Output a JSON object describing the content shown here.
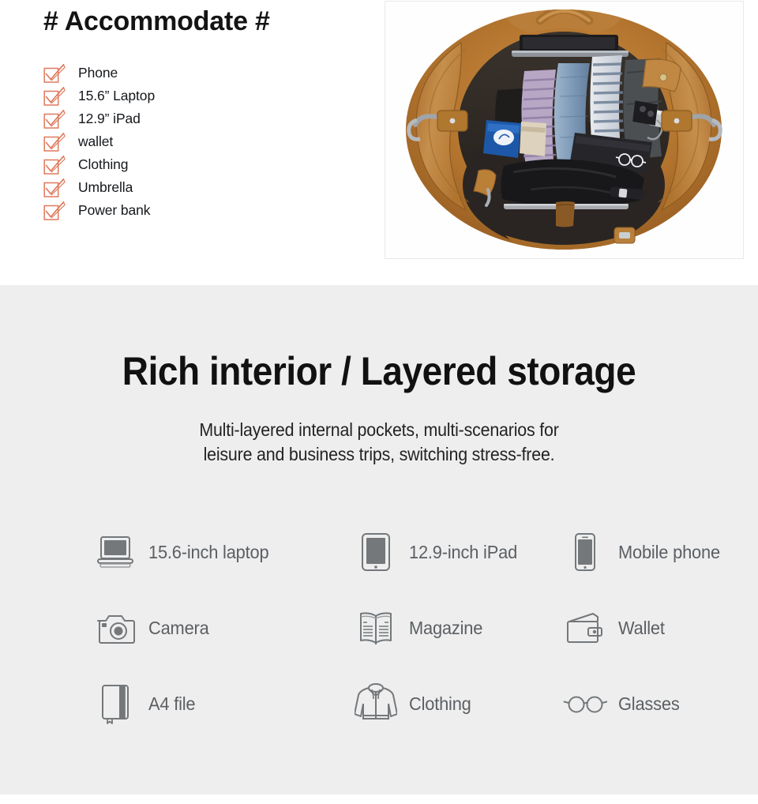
{
  "accommodate": {
    "title": "# Accommodate #",
    "check_color": "#e0795c",
    "items": [
      {
        "label": "Phone",
        "icon": "checkbox-checked-icon"
      },
      {
        "label": "15.6” Laptop",
        "icon": "checkbox-checked-icon"
      },
      {
        "label": "12.9” iPad",
        "icon": "checkbox-checked-icon"
      },
      {
        "label": "wallet",
        "icon": "checkbox-checked-icon"
      },
      {
        "label": "Clothing",
        "icon": "checkbox-checked-icon"
      },
      {
        "label": "Umbrella",
        "icon": "checkbox-checked-icon"
      },
      {
        "label": "Power bank",
        "icon": "checkbox-checked-icon"
      }
    ]
  },
  "photo": {
    "name": "duffel-bag-interior-photo",
    "alt": "Top-down view of an open tan leather duffel bag packed with folded clothing, laptop, documents, keys, glasses case and an umbrella",
    "leather_color": "#b8793a",
    "lining_color": "#2e2a27"
  },
  "storage": {
    "heading": "Rich interior / Layered storage",
    "subtitle_line1": "Multi-layered internal pockets, multi-scenarios for",
    "subtitle_line2": "leisure and business trips, switching stress-free.",
    "background_color": "#eeeeee",
    "icon_color": "#6f7376"
  },
  "capacity": {
    "rows": [
      [
        {
          "label": "15.6-inch laptop",
          "icon": "laptop-icon"
        },
        {
          "label": "12.9-inch iPad",
          "icon": "tablet-icon"
        },
        {
          "label": "Mobile phone",
          "icon": "mobile-phone-icon"
        }
      ],
      [
        {
          "label": "Camera",
          "icon": "camera-icon"
        },
        {
          "label": "Magazine",
          "icon": "open-book-icon"
        },
        {
          "label": "Wallet",
          "icon": "wallet-icon"
        }
      ],
      [
        {
          "label": "A4 file",
          "icon": "notebook-icon"
        },
        {
          "label": "Clothing",
          "icon": "hoodie-icon"
        },
        {
          "label": "Glasses",
          "icon": "glasses-icon"
        }
      ]
    ]
  }
}
